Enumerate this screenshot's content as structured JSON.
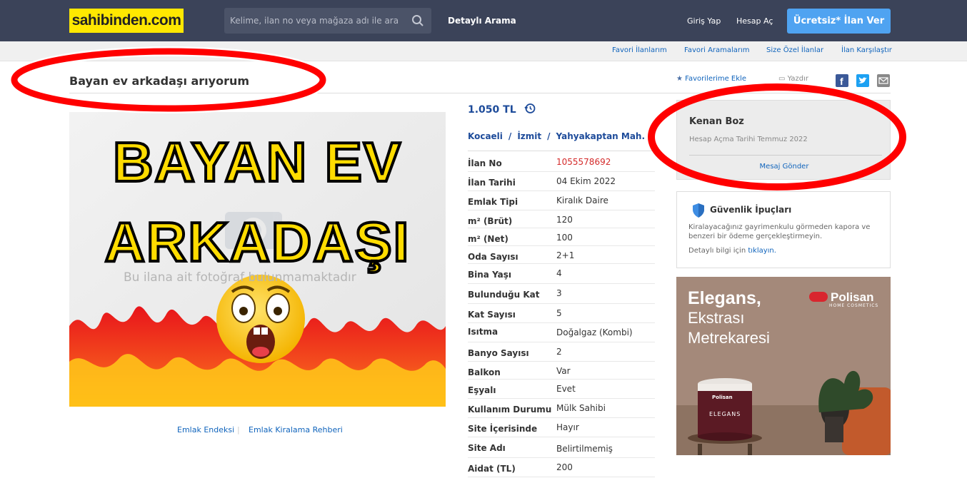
{
  "header": {
    "logo": "sahibinden.com",
    "search_placeholder": "Kelime, ilan no veya mağaza adı ile ara",
    "detailed_search": "Detaylı Arama",
    "login": "Giriş Yap",
    "register": "Hesap Aç",
    "post_ad": "Ücretsiz* İlan Ver"
  },
  "subnav": [
    "Favori İlanlarım",
    "Favori Aramalarım",
    "Size Özel İlanlar",
    "İlan Karşılaştır"
  ],
  "listing": {
    "title": "Bayan ev arkadaşı arıyorum",
    "add_favorite": "Favorilerime Ekle",
    "print": "Yazdır",
    "price": "1.050 TL",
    "location": [
      "Kocaeli",
      "İzmit",
      "Yahyakaptan Mah."
    ],
    "location_separator": "/",
    "photo_placeholder": "Bu ilana ait fotoğraf bulunmamaktadır",
    "overlay_line1": "BAYAN EV",
    "overlay_line2": "ARKADAŞI",
    "photo_links": [
      "Emlak Endeksi",
      "Emlak Kiralama Rehberi"
    ],
    "photo_links_sep": "|",
    "specs": [
      {
        "k": "İlan No",
        "v": "1055578692"
      },
      {
        "k": "İlan Tarihi",
        "v": "04 Ekim 2022"
      },
      {
        "k": "Emlak Tipi",
        "v": "Kiralık Daire"
      },
      {
        "k": "m² (Brüt)",
        "v": "120"
      },
      {
        "k": "m² (Net)",
        "v": "100"
      },
      {
        "k": "Oda Sayısı",
        "v": "2+1"
      },
      {
        "k": "Bina Yaşı",
        "v": "4"
      },
      {
        "k": "Bulunduğu Kat",
        "v": "3"
      },
      {
        "k": "Kat Sayısı",
        "v": "5"
      },
      {
        "k": "Isıtma",
        "v": "Doğalgaz (Kombi)"
      },
      {
        "k": "Banyo Sayısı",
        "v": "2"
      },
      {
        "k": "Balkon",
        "v": "Var"
      },
      {
        "k": "Eşyalı",
        "v": "Evet"
      },
      {
        "k": "Kullanım Durumu",
        "v": "Mülk Sahibi"
      },
      {
        "k": "Site İçerisinde",
        "v": "Hayır"
      },
      {
        "k": "Site Adı",
        "v": "Belirtilmemiş"
      },
      {
        "k": "Aidat (TL)",
        "v": "200"
      }
    ]
  },
  "seller": {
    "name": "Kenan Boz",
    "since": "Hesap Açma Tarihi  Temmuz 2022",
    "message": "Mesaj Gönder"
  },
  "tips": {
    "title": "Güvenlik İpuçları",
    "body": "Kiralayacağınız gayrimenkulu görmeden kapora ve benzeri bir ödeme gerçekleştirmeyin.",
    "more_prefix": "Detaylı bilgi için",
    "more_link": "tıklayın."
  },
  "ad": {
    "line1": "Elegans,",
    "line2": "Ekstrası",
    "line3": "Metrekaresi",
    "brand": "Polisan",
    "brand_sub": "HOME COSMETICS",
    "can_brand": "Polisan",
    "can_name": "ELEGANS"
  },
  "colors": {
    "topbar": "#3b4359",
    "logo_bg": "#ffe800",
    "cta": "#4fa3f1",
    "link": "#1064bc",
    "annotation": "#ff0000"
  }
}
